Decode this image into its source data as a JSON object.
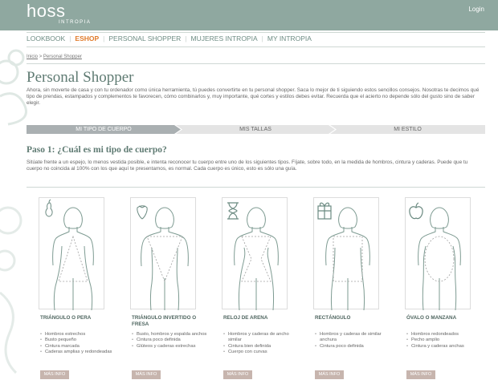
{
  "header": {
    "logo_name": "hoss",
    "logo_sub": "INTROPIA",
    "login_label": "Login"
  },
  "nav": {
    "items": [
      "LOOKBOOK",
      "ESHOP",
      "PERSONAL SHOPPER",
      "MUJERES INTROPIA",
      "MY INTROPIA"
    ],
    "active": "ESHOP"
  },
  "breadcrumb": {
    "home": "Inicio",
    "separator": ">",
    "current": "Personal Shopper"
  },
  "page": {
    "title": "Personal Shopper",
    "intro": "Ahora, sin moverte de casa y con tu ordenador como única herramienta, tú puedes convertirte en tu personal shopper. Saca lo mejor de ti siguiendo estos sencillos consejos. Nosotras te decimos qué tipo de prendas, estampados y complementos te favorecen, cómo combinarlos y, muy importante, qué cortes y estilos debes evitar. Recuerda que el acierto no depende sólo del gusto sino de saber elegir."
  },
  "steps": [
    {
      "label": "MI TIPO DE CUERPO",
      "active": true
    },
    {
      "label": "MIS TALLAS",
      "active": false
    },
    {
      "label": "MI ESTILO",
      "active": false
    }
  ],
  "step1": {
    "heading": "Paso 1: ¿Cuál es mi tipo de cuerpo?",
    "text": "Sitúate frente a un espejo, lo menos vestida posible, e intenta reconocer tu cuerpo entre uno de los siguientes tipos. Fíjate, sobre todo, en la medida de hombros, cintura y caderas. Puede que tu cuerpo no coincida al 100% con los que aquí te presentamos, es normal. Cada cuerpo es único, esto es sólo una guía."
  },
  "body_types": [
    {
      "icon": "pear-icon",
      "title": "TRIÁNGULO O PERA",
      "traits": [
        "Hombros estrechos",
        "Busto pequeño",
        "Cintura marcada",
        "Caderas amplias y redondeadas"
      ],
      "button": "MÁS INFO"
    },
    {
      "icon": "strawberry-icon",
      "title": "TRIÁNGULO INVERTIDO O FRESA",
      "traits": [
        "Busto, hombros y espalda anchos",
        "Cintura poco definida",
        "Glúteos y caderas estrechas"
      ],
      "button": "MÁS INFO"
    },
    {
      "icon": "hourglass-icon",
      "title": "RELOJ DE ARENA",
      "traits": [
        "Hombros y caderas de ancho similar",
        "Cintura bien definida",
        "Cuerpo con curvas"
      ],
      "button": "MÁS INFO"
    },
    {
      "icon": "gift-box-icon",
      "title": "RECTÁNGULO",
      "traits": [
        "Hombros y caderas de similar anchura",
        "Cintura poco definida"
      ],
      "button": "MÁS INFO"
    },
    {
      "icon": "apple-icon",
      "title": "ÓVALO O MANZANA",
      "traits": [
        "Hombros redondeados",
        "Pecho amplio",
        "Cintura y caderas anchas"
      ],
      "button": "MÁS INFO"
    }
  ],
  "colors": {
    "header_bg": "#8fa8a0",
    "accent_active": "#e07b2a",
    "heading": "#5f7b73",
    "button_bg": "#c7b5ae"
  }
}
